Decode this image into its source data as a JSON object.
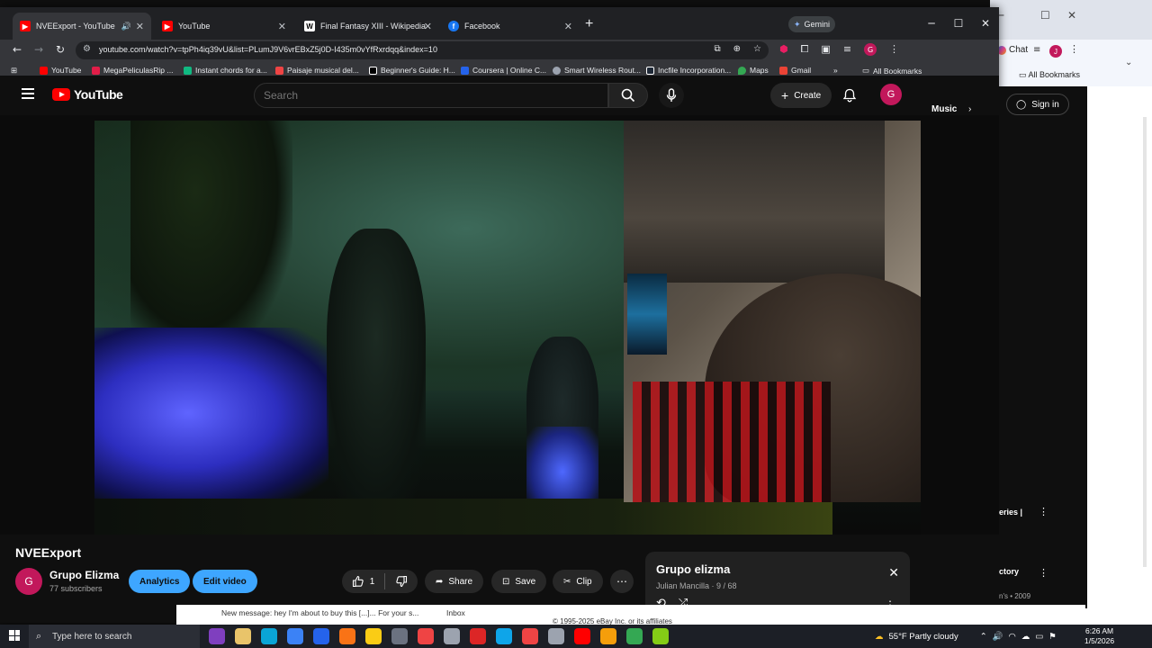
{
  "browser": {
    "tabs": [
      {
        "label": "NVEExport - YouTube",
        "active": true,
        "color": "#ff0000"
      },
      {
        "label": "YouTube",
        "active": false,
        "color": "#ff0000"
      },
      {
        "label": "Final Fantasy XIII - Wikipedia",
        "active": false,
        "color": "#ffffff"
      },
      {
        "label": "Facebook",
        "active": false,
        "color": "#1877f2"
      }
    ],
    "gemini_label": "Gemini",
    "url": "youtube.com/watch?v=tpPh4iq39vU&list=PLumJ9V6vrEBxZ5j0D-I435m0vYfRxrdqq&index=10",
    "bookmarks": [
      "YouTube",
      "MegaPeliculasRip ...",
      "Instant chords for a...",
      "Paisaje musical del...",
      "Beginner's Guide: H...",
      "Coursera | Online C...",
      "Smart Wireless Rout...",
      "Incfile Incorporation...",
      "Maps",
      "Gmail"
    ],
    "all_bookmarks": "All Bookmarks",
    "more_bookmarks": "»",
    "profile_initial": "G"
  },
  "bg_browser": {
    "chat_label": "Chat",
    "all_bookmarks": "All Bookmarks",
    "profile_initial": "J",
    "music_chip": "Music",
    "signin_label": "Sign in",
    "side_items": [
      {
        "label": "eries |"
      },
      {
        "label": "ctory"
      },
      {
        "label": "n's • 2009"
      }
    ]
  },
  "youtube": {
    "logo_text": "YouTube",
    "search_placeholder": "Search",
    "create_label": "Create",
    "avatar_initial": "G",
    "video_title": "NVEExport",
    "channel_name": "Grupo Elizma",
    "subscribers": "77 subscribers",
    "channel_initial": "G",
    "analytics_label": "Analytics",
    "edit_label": "Edit video",
    "like_count": "1",
    "share_label": "Share",
    "save_label": "Save",
    "clip_label": "Clip",
    "more_label": "⋯"
  },
  "playlist": {
    "title": "Grupo elizma",
    "owner": "Julian Mancilla",
    "position": "9 / 68",
    "separator": " · "
  },
  "under_page": {
    "message": "New message: hey I'm about to buy this [...]... For your s...",
    "inbox": "Inbox",
    "copyright": "© 1995-2025 eBay Inc. or its affiliates"
  },
  "taskbar": {
    "search_placeholder": "Type here to search",
    "weather": "55°F  Partly cloudy",
    "time": "6:26 AM",
    "date": "1/5/2026",
    "icon_colors": [
      "#7f3fbf",
      "#e9c46a",
      "#0aa5d6",
      "#3b82f6",
      "#2563eb",
      "#f97316",
      "#facc15",
      "#6b7280",
      "#ef4444",
      "#9ca3af",
      "#dc2626",
      "#0ea5e9",
      "#ef4444",
      "#9ca3af",
      "#ff0000",
      "#f59e0b",
      "#34a853",
      "#84cc16"
    ]
  }
}
